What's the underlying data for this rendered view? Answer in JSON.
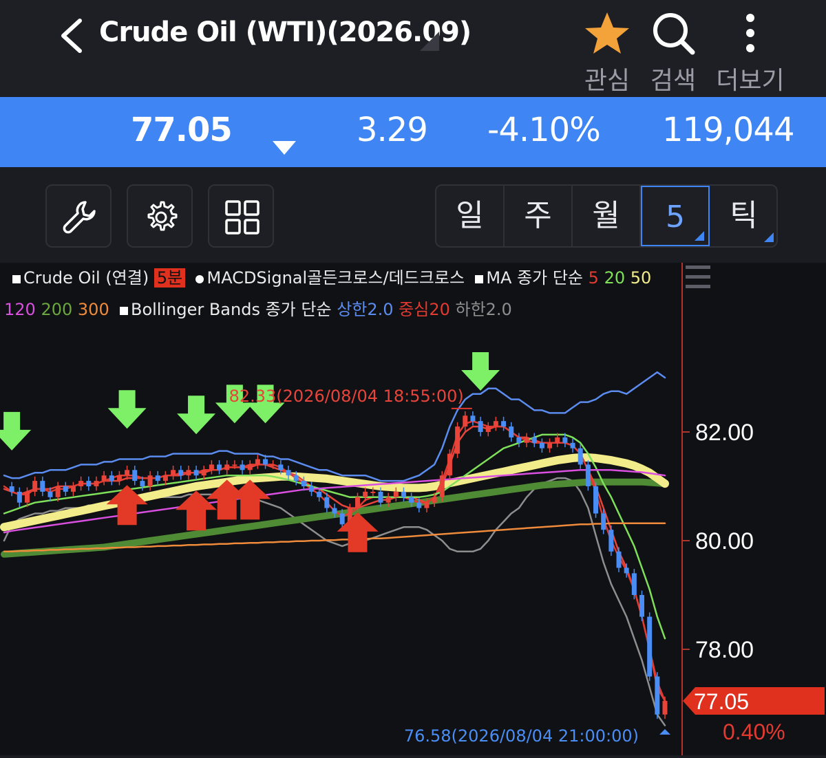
{
  "header": {
    "title": "Crude Oil (WTI)(2026.09)",
    "actions": [
      {
        "label": "관심",
        "icon": "star-icon",
        "color": "#f3a33a"
      },
      {
        "label": "검색",
        "icon": "search-icon"
      },
      {
        "label": "더보기",
        "icon": "more-vertical-icon"
      }
    ]
  },
  "quote": {
    "price": "77.05",
    "direction": "down",
    "change": "3.29",
    "change_pct": "-4.10%",
    "volume": "119,044",
    "background": "#3f86f4"
  },
  "toolbar": {
    "tools": [
      "wrench-icon",
      "gear-icon",
      "grid-icon"
    ],
    "periods": [
      "일",
      "주",
      "월",
      "5",
      "틱"
    ],
    "active_period": "5"
  },
  "legend": {
    "l1_symbol": "Crude Oil (연결)",
    "l1_badge": "5분",
    "l1_macd": "MACDSignal골든크로스/데드크로스",
    "l1_ma": "MA 종가 단순",
    "ma5": "5",
    "ma20": "20",
    "ma50": "50",
    "ma120": "120",
    "ma200": "200",
    "ma300": "300",
    "bb": "Bollinger Bands 종가 단순",
    "bb_upper": "상한2.0",
    "bb_mid": "중심20",
    "bb_lower": "하한2.0"
  },
  "chart_data": {
    "type": "candlestick",
    "interval": "5분",
    "y_axis_ticks": [
      "82.00",
      "80.00",
      "78.00"
    ],
    "ylim": [
      76.3,
      83.4
    ],
    "current_price_label": "77.05",
    "current_pct_label": "0.40%",
    "annotations": {
      "high": "82.33(2026/08/04 18:55:00)",
      "low": "76.58(2026/08/04 21:00:00)"
    },
    "close_series": [
      81.0,
      80.9,
      80.7,
      80.9,
      81.1,
      80.9,
      80.8,
      81.0,
      80.9,
      81.0,
      81.1,
      81.0,
      81.1,
      81.2,
      81.1,
      81.2,
      81.3,
      81.1,
      81.0,
      81.2,
      81.1,
      81.2,
      81.3,
      81.2,
      81.3,
      81.2,
      81.3,
      81.4,
      81.3,
      81.4,
      81.4,
      81.3,
      81.4,
      81.5,
      81.4,
      81.4,
      81.3,
      81.2,
      81.1,
      81.0,
      80.9,
      80.8,
      80.6,
      80.5,
      80.3,
      80.6,
      80.8,
      80.9,
      80.9,
      80.7,
      80.8,
      80.9,
      80.8,
      80.7,
      80.6,
      80.7,
      80.8,
      81.2,
      81.6,
      82.1,
      82.3,
      82.2,
      82.0,
      82.1,
      82.2,
      82.1,
      81.9,
      81.8,
      81.9,
      81.8,
      81.7,
      81.8,
      81.9,
      81.8,
      81.7,
      81.4,
      81.0,
      80.5,
      80.2,
      79.8,
      79.5,
      79.4,
      79.0,
      78.6,
      77.5,
      76.8,
      77.05
    ],
    "signals": {
      "sell_arrows": [
        1,
        16,
        25,
        30,
        34,
        62
      ],
      "buy_arrows": [
        16,
        25,
        29,
        32,
        46
      ]
    },
    "series": [
      {
        "name": "상한2.0",
        "color": "#5b8cf0",
        "values": [
          81.2,
          81.15,
          81.15,
          81.2,
          81.25,
          81.25,
          81.3,
          81.3,
          81.3,
          81.35,
          81.4,
          81.4,
          81.4,
          81.45,
          81.45,
          81.5,
          81.5,
          81.5,
          81.5,
          81.55,
          81.55,
          81.55,
          81.6,
          81.6,
          81.6,
          81.6,
          81.6,
          81.6,
          81.65,
          81.65,
          81.6,
          81.6,
          81.6,
          81.6,
          81.55,
          81.55,
          81.5,
          81.5,
          81.45,
          81.4,
          81.35,
          81.3,
          81.3,
          81.25,
          81.2,
          81.2,
          81.2,
          81.2,
          81.15,
          81.1,
          81.1,
          81.1,
          81.1,
          81.15,
          81.2,
          81.3,
          81.4,
          81.7,
          82.1,
          82.4,
          82.6,
          82.7,
          82.7,
          82.8,
          82.8,
          82.7,
          82.6,
          82.6,
          82.5,
          82.4,
          82.4,
          82.35,
          82.35,
          82.35,
          82.45,
          82.55,
          82.55,
          82.6,
          82.7,
          82.75,
          82.75,
          82.7,
          82.8,
          82.9,
          83.0,
          83.1,
          83.0
        ]
      },
      {
        "name": "하한2.0",
        "color": "#8e8e8e",
        "values": [
          80.0,
          80.3,
          80.4,
          80.45,
          80.5,
          80.5,
          80.55,
          80.55,
          80.6,
          80.6,
          80.6,
          80.65,
          80.65,
          80.7,
          80.7,
          80.7,
          80.75,
          80.75,
          80.75,
          80.8,
          80.8,
          80.8,
          80.8,
          80.8,
          80.85,
          80.85,
          80.85,
          80.85,
          80.85,
          80.9,
          80.9,
          80.85,
          80.8,
          80.75,
          80.7,
          80.65,
          80.6,
          80.5,
          80.4,
          80.3,
          80.2,
          80.1,
          80.0,
          79.95,
          79.9,
          79.95,
          80.0,
          80.0,
          80.05,
          80.1,
          80.15,
          80.2,
          80.25,
          80.25,
          80.25,
          80.2,
          80.1,
          80.0,
          79.85,
          79.8,
          79.8,
          79.8,
          79.85,
          80.0,
          80.2,
          80.35,
          80.5,
          80.6,
          80.8,
          80.95,
          81.05,
          81.1,
          81.15,
          81.15,
          81.1,
          80.9,
          80.6,
          80.1,
          79.6,
          79.2,
          78.9,
          78.6,
          78.2,
          77.8,
          77.3,
          76.8,
          76.6
        ]
      },
      {
        "name": "중심20",
        "color": "#e8443a",
        "values": [
          80.95,
          80.9,
          80.85,
          80.9,
          80.95,
          80.95,
          80.95,
          81.0,
          81.0,
          81.0,
          81.05,
          81.05,
          81.05,
          81.1,
          81.1,
          81.1,
          81.15,
          81.15,
          81.15,
          81.15,
          81.15,
          81.2,
          81.2,
          81.2,
          81.25,
          81.25,
          81.25,
          81.3,
          81.3,
          81.35,
          81.35,
          81.35,
          81.35,
          81.4,
          81.4,
          81.35,
          81.3,
          81.25,
          81.2,
          81.1,
          81.0,
          80.95,
          80.85,
          80.75,
          80.65,
          80.6,
          80.6,
          80.65,
          80.7,
          80.75,
          80.75,
          80.8,
          80.8,
          80.8,
          80.75,
          80.7,
          80.8,
          81.0,
          81.4,
          81.8,
          82.0,
          82.1,
          82.1,
          82.05,
          82.1,
          82.1,
          82.0,
          81.9,
          81.9,
          81.85,
          81.8,
          81.8,
          81.8,
          81.8,
          81.75,
          81.6,
          81.3,
          81.0,
          80.6,
          80.2,
          79.8,
          79.5,
          79.1,
          78.6,
          78.0,
          77.3,
          77.05
        ]
      },
      {
        "name": "5",
        "color": "#e23a30",
        "values": [
          81.0,
          80.9,
          80.85,
          80.85,
          80.95,
          80.95,
          80.9,
          80.95,
          80.95,
          81.0,
          81.05,
          81.05,
          81.05,
          81.1,
          81.15,
          81.2,
          81.2,
          81.2,
          81.15,
          81.15,
          81.15,
          81.2,
          81.2,
          81.25,
          81.25,
          81.25,
          81.3,
          81.3,
          81.3,
          81.35,
          81.35,
          81.35,
          81.4,
          81.4,
          81.4,
          81.4,
          81.35,
          81.25,
          81.15,
          81.05,
          80.95,
          80.85,
          80.7,
          80.55,
          80.45,
          80.5,
          80.6,
          80.75,
          80.8,
          80.8,
          80.8,
          80.8,
          80.8,
          80.75,
          80.7,
          80.7,
          80.8,
          81.1,
          81.5,
          81.95,
          82.15,
          82.2,
          82.15,
          82.1,
          82.1,
          82.1,
          82.0,
          81.9,
          81.85,
          81.8,
          81.8,
          81.8,
          81.8,
          81.8,
          81.75,
          81.6,
          81.3,
          80.9,
          80.4,
          80.0,
          79.7,
          79.45,
          79.1,
          78.6,
          78.0,
          77.4,
          77.05
        ]
      },
      {
        "name": "20",
        "color": "#7fe05a",
        "values": [
          80.5,
          80.55,
          80.6,
          80.65,
          80.7,
          80.72,
          80.74,
          80.76,
          80.78,
          80.8,
          80.82,
          80.84,
          80.86,
          80.88,
          80.9,
          80.92,
          80.94,
          80.96,
          80.98,
          81.0,
          81.02,
          81.04,
          81.06,
          81.08,
          81.1,
          81.12,
          81.14,
          81.16,
          81.18,
          81.2,
          81.2,
          81.2,
          81.2,
          81.2,
          81.2,
          81.18,
          81.15,
          81.12,
          81.08,
          81.04,
          81.0,
          80.96,
          80.92,
          80.88,
          80.84,
          80.8,
          80.8,
          80.8,
          80.8,
          80.8,
          80.8,
          80.8,
          80.8,
          80.8,
          80.8,
          80.82,
          80.85,
          80.9,
          81.0,
          81.1,
          81.2,
          81.3,
          81.4,
          81.5,
          81.6,
          81.7,
          81.75,
          81.8,
          81.85,
          81.9,
          81.95,
          81.95,
          81.95,
          81.95,
          81.9,
          81.8,
          81.6,
          81.35,
          81.05,
          80.8,
          80.5,
          80.2,
          79.9,
          79.5,
          79.1,
          78.6,
          78.2
        ]
      },
      {
        "name": "50",
        "color": "#f3ec8a",
        "values": [
          80.25,
          80.28,
          80.31,
          80.34,
          80.37,
          80.4,
          80.43,
          80.46,
          80.49,
          80.52,
          80.55,
          80.58,
          80.61,
          80.64,
          80.67,
          80.7,
          80.73,
          80.76,
          80.79,
          80.82,
          80.85,
          80.88,
          80.91,
          80.94,
          80.97,
          81.0,
          81.02,
          81.04,
          81.06,
          81.08,
          81.1,
          81.12,
          81.14,
          81.15,
          81.16,
          81.17,
          81.18,
          81.18,
          81.18,
          81.17,
          81.16,
          81.15,
          81.14,
          81.12,
          81.1,
          81.08,
          81.06,
          81.04,
          81.02,
          81.0,
          80.99,
          80.98,
          80.97,
          80.97,
          80.97,
          80.98,
          81.0,
          81.03,
          81.06,
          81.09,
          81.12,
          81.15,
          81.18,
          81.21,
          81.24,
          81.27,
          81.3,
          81.33,
          81.36,
          81.39,
          81.42,
          81.45,
          81.48,
          81.5,
          81.52,
          81.53,
          81.53,
          81.52,
          81.5,
          81.48,
          81.45,
          81.42,
          81.38,
          81.32,
          81.25,
          81.15,
          81.05
        ]
      },
      {
        "name": "120",
        "color": "#d94fe0",
        "values": [
          80.15,
          80.18,
          80.2,
          80.22,
          80.24,
          80.26,
          80.28,
          80.3,
          80.32,
          80.34,
          80.36,
          80.38,
          80.4,
          80.42,
          80.44,
          80.46,
          80.48,
          80.5,
          80.52,
          80.54,
          80.56,
          80.58,
          80.6,
          80.62,
          80.64,
          80.66,
          80.68,
          80.7,
          80.72,
          80.74,
          80.76,
          80.78,
          80.8,
          80.82,
          80.84,
          80.86,
          80.88,
          80.9,
          80.92,
          80.94,
          80.95,
          80.96,
          80.97,
          80.98,
          80.99,
          81.0,
          81.01,
          81.02,
          81.03,
          81.04,
          81.05,
          81.06,
          81.07,
          81.08,
          81.09,
          81.1,
          81.11,
          81.12,
          81.13,
          81.14,
          81.15,
          81.16,
          81.17,
          81.18,
          81.19,
          81.2,
          81.21,
          81.22,
          81.23,
          81.24,
          81.25,
          81.26,
          81.27,
          81.28,
          81.29,
          81.3,
          81.3,
          81.3,
          81.3,
          81.3,
          81.29,
          81.28,
          81.27,
          81.26,
          81.24,
          81.22,
          81.2
        ]
      },
      {
        "name": "200",
        "color": "#4f8a34",
        "values": [
          79.75,
          79.76,
          79.77,
          79.78,
          79.79,
          79.8,
          79.81,
          79.82,
          79.83,
          79.84,
          79.85,
          79.86,
          79.87,
          79.88,
          79.9,
          79.92,
          79.94,
          79.96,
          79.98,
          80.0,
          80.02,
          80.04,
          80.06,
          80.08,
          80.1,
          80.12,
          80.14,
          80.16,
          80.18,
          80.2,
          80.22,
          80.24,
          80.26,
          80.28,
          80.3,
          80.32,
          80.34,
          80.36,
          80.38,
          80.4,
          80.42,
          80.44,
          80.46,
          80.48,
          80.5,
          80.52,
          80.54,
          80.56,
          80.58,
          80.6,
          80.62,
          80.64,
          80.66,
          80.68,
          80.7,
          80.72,
          80.74,
          80.76,
          80.78,
          80.8,
          80.82,
          80.84,
          80.86,
          80.88,
          80.9,
          80.92,
          80.94,
          80.96,
          80.98,
          81.0,
          81.02,
          81.03,
          81.04,
          81.05,
          81.06,
          81.07,
          81.08,
          81.08,
          81.08,
          81.08,
          81.08,
          81.08,
          81.08,
          81.08,
          81.07,
          81.06,
          81.05
        ]
      },
      {
        "name": "300",
        "color": "#ef8b3a",
        "values": [
          79.8,
          79.8,
          79.81,
          79.81,
          79.82,
          79.82,
          79.83,
          79.83,
          79.84,
          79.84,
          79.85,
          79.85,
          79.86,
          79.86,
          79.87,
          79.87,
          79.88,
          79.88,
          79.89,
          79.89,
          79.9,
          79.9,
          79.91,
          79.91,
          79.92,
          79.92,
          79.93,
          79.93,
          79.94,
          79.94,
          79.95,
          79.95,
          79.96,
          79.96,
          79.97,
          79.97,
          79.98,
          79.98,
          79.99,
          79.99,
          80.0,
          80.0,
          80.01,
          80.01,
          80.02,
          80.02,
          80.03,
          80.03,
          80.04,
          80.04,
          80.05,
          80.06,
          80.07,
          80.08,
          80.09,
          80.1,
          80.11,
          80.12,
          80.13,
          80.14,
          80.15,
          80.16,
          80.17,
          80.18,
          80.19,
          80.2,
          80.21,
          80.22,
          80.23,
          80.24,
          80.25,
          80.26,
          80.27,
          80.28,
          80.29,
          80.3,
          80.3,
          80.31,
          80.31,
          80.32,
          80.32,
          80.32,
          80.32,
          80.32,
          80.32,
          80.32,
          80.32
        ]
      }
    ]
  }
}
